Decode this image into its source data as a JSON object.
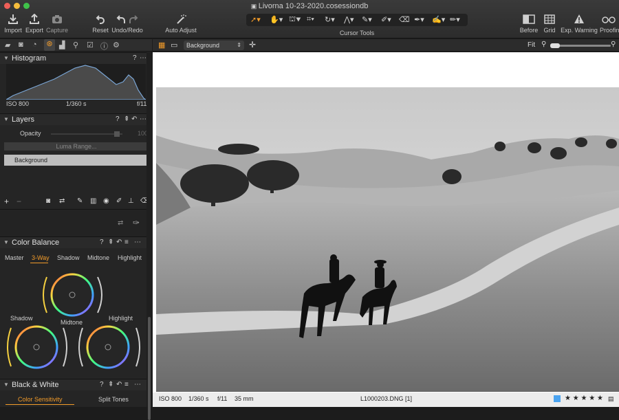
{
  "window": {
    "title": "Livorna 10-23-2020.cosessiondb"
  },
  "toolbar": {
    "import": "Import",
    "export": "Export",
    "capture": "Capture",
    "reset": "Reset",
    "undo_redo": "Undo/Redo",
    "auto_adjust": "Auto Adjust",
    "cursor_tools": "Cursor Tools",
    "before": "Before",
    "grid": "Grid",
    "exp_warning": "Exp. Warning",
    "proofing": "Proofing"
  },
  "viewer_bar": {
    "variant": "Background",
    "zoom": "Fit"
  },
  "histogram": {
    "title": "Histogram",
    "iso": "ISO 800",
    "shutter": "1/360 s",
    "aperture": "f/11"
  },
  "layers": {
    "title": "Layers",
    "opacity_label": "Opacity",
    "opacity_value": "100",
    "luma_range": "Luma Range...",
    "layer_name": "Background"
  },
  "color_balance": {
    "title": "Color Balance",
    "tabs": [
      "Master",
      "3-Way",
      "Shadow",
      "Midtone",
      "Highlight"
    ],
    "active_tab": "3-Way",
    "wheels": {
      "shadow": "Shadow",
      "midtone": "Midtone",
      "highlight": "Highlight"
    }
  },
  "black_white": {
    "title": "Black & White",
    "tabs": [
      "Color Sensitivity",
      "Split Tones"
    ],
    "active_tab": "Color Sensitivity"
  },
  "status_bar": {
    "iso": "ISO 800",
    "shutter": "1/360 s",
    "aperture": "f/11",
    "focal": "35 mm",
    "filename": "L1000203.DNG [1]",
    "rating_stars": "★ ★ ★ ★ ★"
  },
  "colors": {
    "accent": "#f39c2a",
    "label_blue": "#4aa3f0"
  }
}
